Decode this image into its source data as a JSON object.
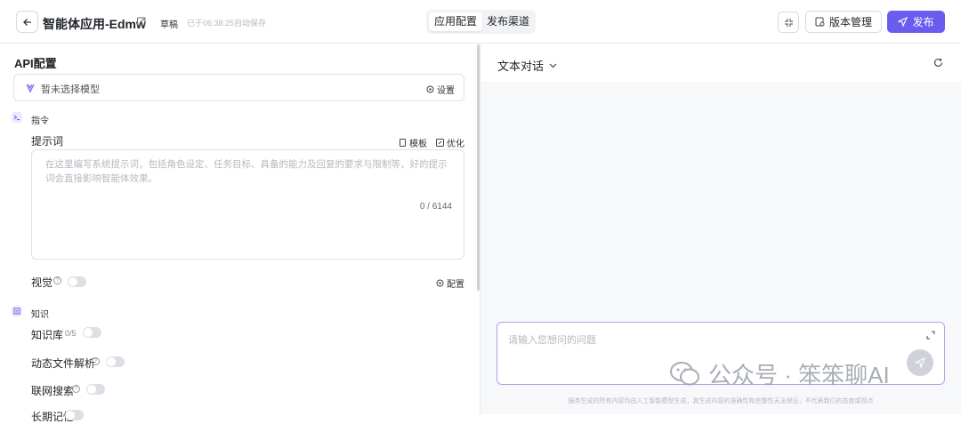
{
  "header": {
    "app_title": "智能体应用-Edmw",
    "status": "草稿",
    "autosave": "已于06:38:25自动保存",
    "tabs": [
      {
        "label": "应用配置",
        "active": true
      },
      {
        "label": "发布渠道",
        "active": false
      }
    ],
    "version_label": "版本管理",
    "publish_label": "发布",
    "accent_color": "#6b5cf0"
  },
  "config": {
    "api_title": "API配置",
    "model_placeholder": "暂未选择模型",
    "model_settings_label": "设置",
    "instructions": {
      "section_label": "指令",
      "prompt_label": "提示词",
      "template_label": "模板",
      "optimize_label": "优化",
      "prompt_placeholder": "在这里编写系统提示词，包括角色设定、任务目标、具备的能力及回复的要求与限制等，好的提示词会直接影响智能体效果。",
      "prompt_count": "0 / 6144",
      "vision_label": "视觉",
      "vision_config_label": "配置"
    },
    "knowledge": {
      "section_label": "知识",
      "kb_label": "知识库",
      "kb_count": "0/5",
      "doc_parse_label": "动态文件解析",
      "web_search_label": "联网搜索",
      "more_label": "长期记忆"
    }
  },
  "preview": {
    "mode_label": "文本对话",
    "input_placeholder": "请输入您想问的问题",
    "disclaimer": "服务生成的所有内容均由人工智能模型生成，其生成内容的准确性和完整性无法保证，不代表我们的态度或观点"
  },
  "watermark": {
    "text": "公众号 · 笨笨聊AI"
  }
}
